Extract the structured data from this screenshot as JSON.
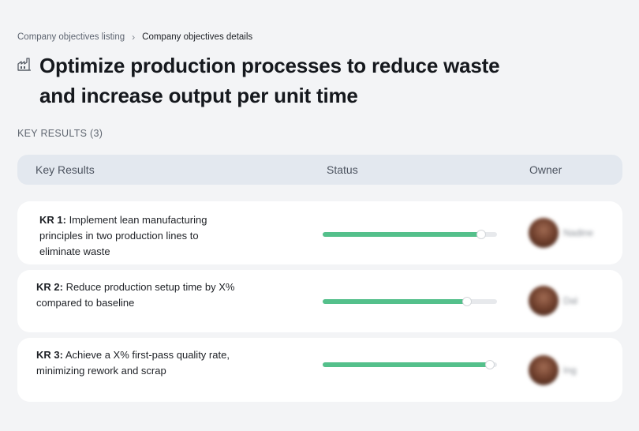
{
  "breadcrumb": {
    "listing": "Company objectives listing",
    "separator": "›",
    "current": "Company objectives details"
  },
  "objective": {
    "icon": "factory-icon",
    "title_line1": "Optimize production processes to reduce waste",
    "title_line2": "and increase output per unit time"
  },
  "key_results_count_label": "KEY RESULTS (3)",
  "table": {
    "columns": {
      "key_results": "Key Results",
      "status": "Status",
      "owner": "Owner"
    }
  },
  "colors": {
    "progress": "#54c08b",
    "header_bg": "#e3e8ef",
    "page_bg": "#f3f4f6"
  },
  "key_results": [
    {
      "tag": "KR 1:",
      "text": "Implement lean manufacturing principles in two production lines to eliminate waste",
      "line1": " Implement lean manufacturing",
      "line2": "principles in two production lines to",
      "line3": "eliminate waste",
      "progress": 0.91,
      "owner": "Nadine"
    },
    {
      "tag": "KR 2:",
      "line1": " Reduce production setup time by X%",
      "line2": "compared to baseline",
      "progress": 0.83,
      "owner": "Dal"
    },
    {
      "tag": "KR 3:",
      "line1": " Achieve a X% first-pass quality rate,",
      "line2": "minimizing rework and scrap",
      "progress": 0.96,
      "owner": "Ing"
    }
  ]
}
